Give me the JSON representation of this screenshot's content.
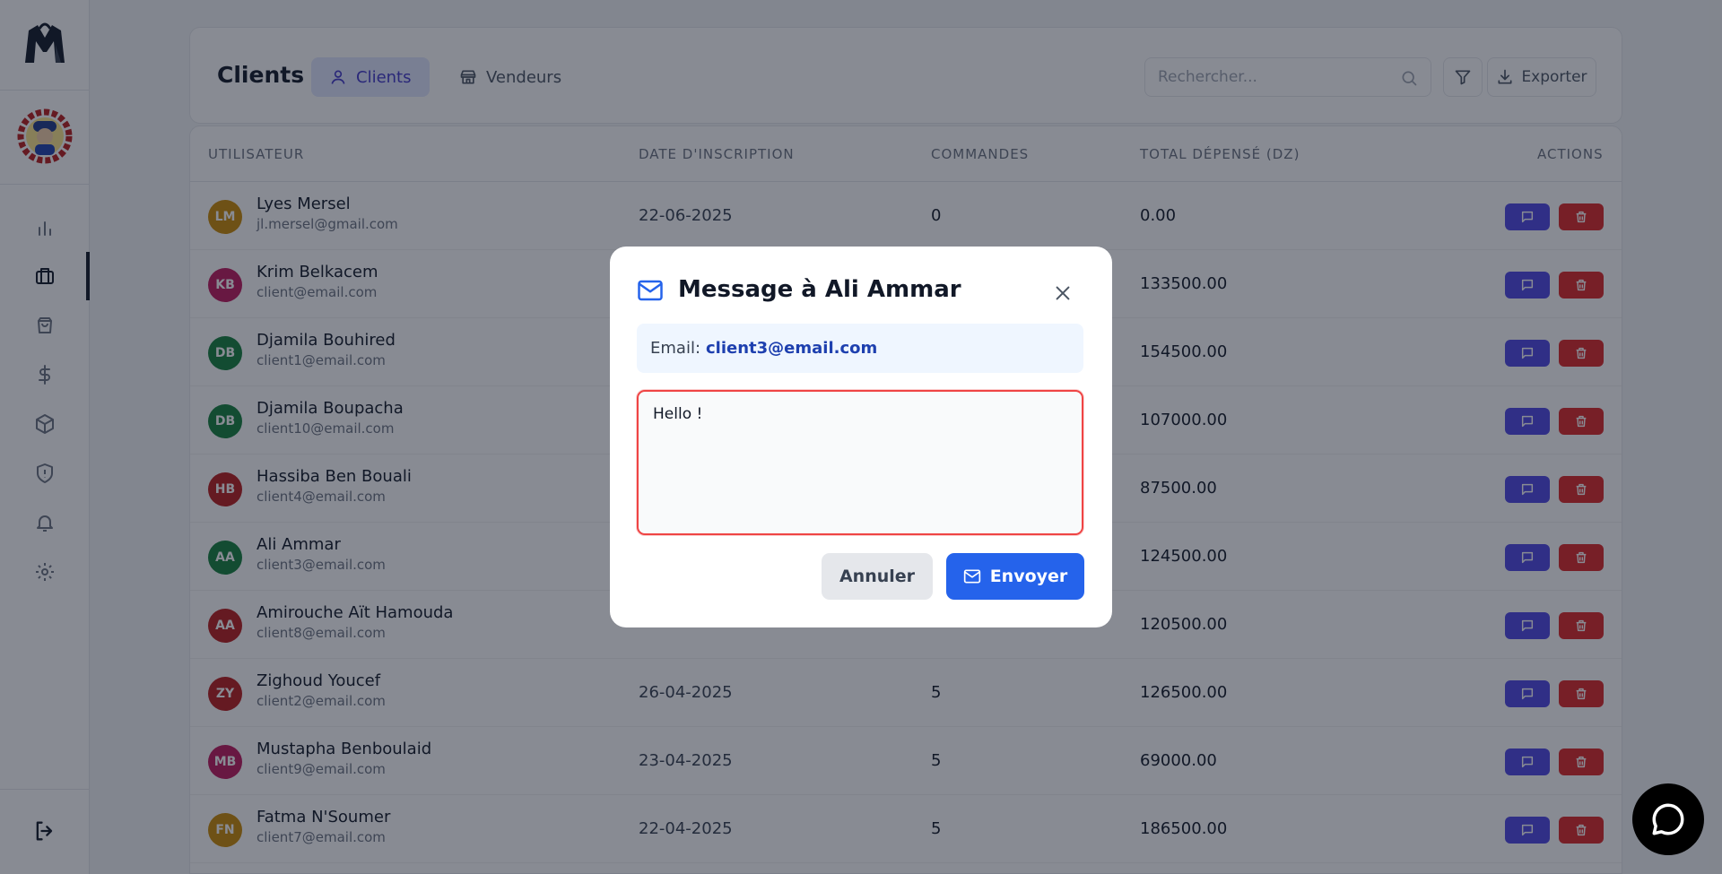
{
  "header": {
    "title": "Clients",
    "tabs": [
      {
        "label": "Clients",
        "icon": "user-icon",
        "active": true
      },
      {
        "label": "Vendeurs",
        "icon": "store-icon",
        "active": false
      }
    ],
    "search_placeholder": "Rechercher...",
    "export_label": "Exporter"
  },
  "table": {
    "columns": [
      "UTILISATEUR",
      "DATE D'INSCRIPTION",
      "COMMANDES",
      "TOTAL DÉPENSÉ (DZ)",
      "ACTIONS"
    ],
    "rows": [
      {
        "initials": "LM",
        "color": "#ca8a04",
        "name": "Lyes Mersel",
        "email": "jl.mersel@gmail.com",
        "date": "22-06-2025",
        "orders": "0",
        "total": "0.00"
      },
      {
        "initials": "KB",
        "color": "#be185d",
        "name": "Krim Belkacem",
        "email": "client@email.com",
        "date": "",
        "orders": "",
        "total": "133500.00"
      },
      {
        "initials": "DB",
        "color": "#15803d",
        "name": "Djamila Bouhired",
        "email": "client1@email.com",
        "date": "",
        "orders": "",
        "total": "154500.00"
      },
      {
        "initials": "DB",
        "color": "#15803d",
        "name": "Djamila Boupacha",
        "email": "client10@email.com",
        "date": "",
        "orders": "",
        "total": "107000.00"
      },
      {
        "initials": "HB",
        "color": "#b91c1c",
        "name": "Hassiba Ben Bouali",
        "email": "client4@email.com",
        "date": "",
        "orders": "",
        "total": "87500.00"
      },
      {
        "initials": "AA",
        "color": "#15803d",
        "name": "Ali Ammar",
        "email": "client3@email.com",
        "date": "",
        "orders": "",
        "total": "124500.00"
      },
      {
        "initials": "AA",
        "color": "#b91c1c",
        "name": "Amirouche Aït Hamouda",
        "email": "client8@email.com",
        "date": "",
        "orders": "",
        "total": "120500.00"
      },
      {
        "initials": "ZY",
        "color": "#b91c1c",
        "name": "Zighoud Youcef",
        "email": "client2@email.com",
        "date": "26-04-2025",
        "orders": "5",
        "total": "126500.00"
      },
      {
        "initials": "MB",
        "color": "#be185d",
        "name": "Mustapha Benboulaid",
        "email": "client9@email.com",
        "date": "23-04-2025",
        "orders": "5",
        "total": "69000.00"
      },
      {
        "initials": "FN",
        "color": "#ca8a04",
        "name": "Fatma N'Soumer",
        "email": "client7@email.com",
        "date": "22-04-2025",
        "orders": "5",
        "total": "186500.00"
      }
    ]
  },
  "modal": {
    "title": "Message à Ali Ammar",
    "email_label": "Email:",
    "email_value": "client3@email.com",
    "message": "Hello !",
    "cancel_label": "Annuler",
    "send_label": "Envoyer"
  },
  "colors": {
    "accent": "#2563eb",
    "message_action": "#4f46e5",
    "delete_action": "#dc2626",
    "textarea_border": "#ef4444"
  }
}
